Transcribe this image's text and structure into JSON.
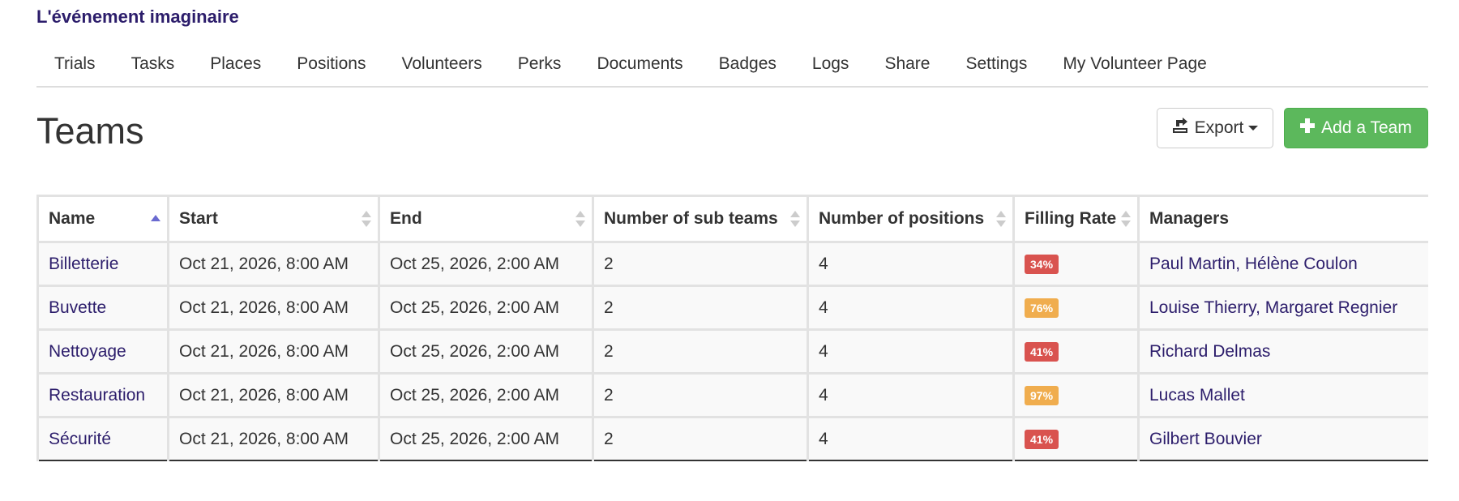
{
  "brand": "L'événement imaginaire",
  "nav": [
    "Trials",
    "Tasks",
    "Places",
    "Positions",
    "Volunteers",
    "Perks",
    "Documents",
    "Badges",
    "Logs",
    "Share",
    "Settings",
    "My Volunteer Page"
  ],
  "page_title": "Teams",
  "toolbar": {
    "export_label": "Export",
    "export_icon": "export-icon",
    "add_label": "Add a Team",
    "add_icon": "plus-icon",
    "add_color": "#5cb85c"
  },
  "table": {
    "columns": [
      "Name",
      "Start",
      "End",
      "Number of sub teams",
      "Number of positions",
      "Filling Rate",
      "Managers"
    ],
    "sorted_column": "Name",
    "rows": [
      {
        "name": "Billetterie",
        "start": "Oct 21, 2026, 8:00 AM",
        "end": "Oct 25, 2026, 2:00 AM",
        "sub_teams": "2",
        "positions": "4",
        "filling_rate": "34%",
        "rate_color": "#d9534f",
        "managers": "Paul Martin, Hélène Coulon"
      },
      {
        "name": "Buvette",
        "start": "Oct 21, 2026, 8:00 AM",
        "end": "Oct 25, 2026, 2:00 AM",
        "sub_teams": "2",
        "positions": "4",
        "filling_rate": "76%",
        "rate_color": "#f0ad4e",
        "managers": "Louise Thierry, Margaret Regnier"
      },
      {
        "name": "Nettoyage",
        "start": "Oct 21, 2026, 8:00 AM",
        "end": "Oct 25, 2026, 2:00 AM",
        "sub_teams": "2",
        "positions": "4",
        "filling_rate": "41%",
        "rate_color": "#d9534f",
        "managers": "Richard Delmas"
      },
      {
        "name": "Restauration",
        "start": "Oct 21, 2026, 8:00 AM",
        "end": "Oct 25, 2026, 2:00 AM",
        "sub_teams": "2",
        "positions": "4",
        "filling_rate": "97%",
        "rate_color": "#f0ad4e",
        "managers": "Lucas Mallet"
      },
      {
        "name": "Sécurité",
        "start": "Oct 21, 2026, 8:00 AM",
        "end": "Oct 25, 2026, 2:00 AM",
        "sub_teams": "2",
        "positions": "4",
        "filling_rate": "41%",
        "rate_color": "#d9534f",
        "managers": "Gilbert Bouvier"
      }
    ]
  }
}
